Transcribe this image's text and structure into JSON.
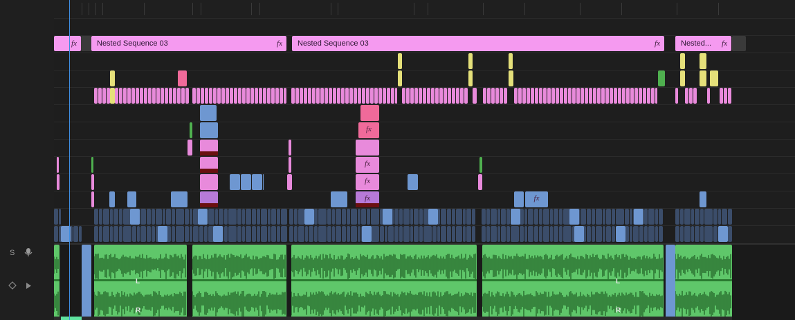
{
  "header": {
    "audio_track": {
      "solo_label": "S",
      "mic_icon": "microphone-icon",
      "keyframe_icon": "keyframe-diamond-icon",
      "expand_icon": "triangle-right-icon"
    }
  },
  "timeline": {
    "nested_clips": [
      {
        "label": "",
        "fx": "fx"
      },
      {
        "label": "Nested Sequence 03",
        "fx": "fx"
      },
      {
        "label": "Nested Sequence 03",
        "fx": "fx"
      },
      {
        "label": "Nested...",
        "fx": "fx"
      }
    ],
    "fx_badges": [
      "fx",
      "fx",
      "fx",
      "fx",
      "fx"
    ],
    "audio_channels": {
      "left": "L",
      "right": "R"
    }
  },
  "colors": {
    "nested_clip": "#f59af0",
    "pink_clip": "#e88adb",
    "blue_clip": "#6e97d1",
    "dark_blue_clip": "#3b4d6a",
    "yellow_clip": "#e5e07a",
    "audio_clip": "#5fc76a",
    "playhead": "#3e8de0"
  }
}
